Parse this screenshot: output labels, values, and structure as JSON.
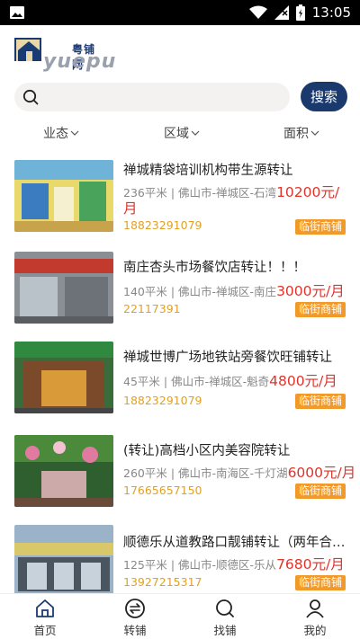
{
  "status_bar": {
    "time": "13:05"
  },
  "app": {
    "logo_cn": "粤铺网",
    "logo_en": "yuepu"
  },
  "search": {
    "placeholder": "",
    "button_label": "搜索"
  },
  "filters": [
    {
      "label": "业态"
    },
    {
      "label": "区域"
    },
    {
      "label": "面积"
    }
  ],
  "listings": [
    {
      "title": "禅城精袋培训机构带生源转让",
      "area": "236平米",
      "location": "佛山市-禅城区-石湾",
      "price": "10200元/",
      "price_cont": "月",
      "phone": "18823291079",
      "badge": "临街商铺"
    },
    {
      "title": "南庄杏头市场餐饮店转让！！！",
      "area": "140平米",
      "location": "佛山市-禅城区-南庄",
      "price": "3000元/月",
      "phone": "22117391",
      "badge": "临街商铺"
    },
    {
      "title": "禅城世博广场地铁站旁餐饮旺铺转让",
      "area": "45平米",
      "location": "佛山市-禅城区-魁奇",
      "price": "4800元/月",
      "phone": "18823291079",
      "badge": "临街商铺"
    },
    {
      "title": "(转让)高档小区内美容院转让",
      "area": "260平米",
      "location": "佛山市-南海区-千灯湖",
      "price": "6000元/月",
      "phone": "17665657150",
      "badge": "临街商铺"
    },
    {
      "title": "顺德乐从道教路口靓铺转让（两年合…",
      "area": "125平米",
      "location": "佛山市-顺德区-乐从",
      "price": "7680元/月",
      "phone": "13927215317",
      "badge": "临街商铺"
    }
  ],
  "bottom_nav": [
    {
      "label": "首页",
      "icon": "home-icon"
    },
    {
      "label": "转铺",
      "icon": "transfer-icon"
    },
    {
      "label": "找铺",
      "icon": "search-icon"
    },
    {
      "label": "我的",
      "icon": "user-icon"
    }
  ],
  "colors": {
    "accent": "#1a3a6e",
    "price": "#e0332a",
    "phone": "#e0a127",
    "badge": "#f29a29"
  }
}
